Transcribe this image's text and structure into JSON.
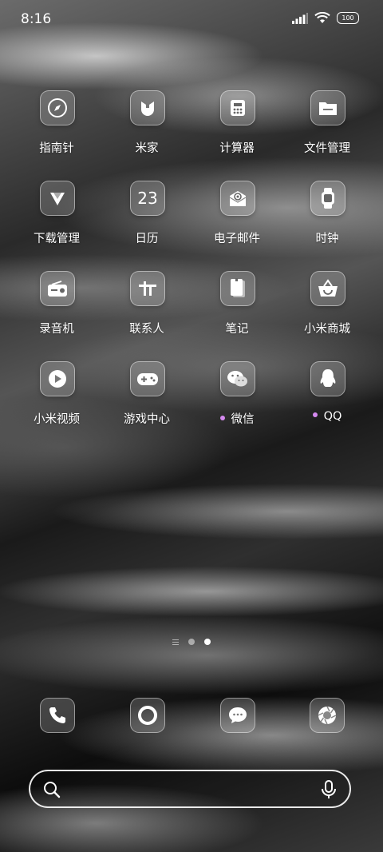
{
  "status_bar": {
    "time": "8:16",
    "battery": "100"
  },
  "apps": [
    {
      "label": "指南针",
      "icon": "compass-icon"
    },
    {
      "label": "米家",
      "icon": "mijia-icon"
    },
    {
      "label": "计算器",
      "icon": "calculator-icon"
    },
    {
      "label": "文件管理",
      "icon": "folder-icon"
    },
    {
      "label": "下载管理",
      "icon": "download-icon"
    },
    {
      "label": "日历",
      "icon": "calendar-icon",
      "icon_text": "23"
    },
    {
      "label": "电子邮件",
      "icon": "email-icon"
    },
    {
      "label": "时钟",
      "icon": "watch-icon"
    },
    {
      "label": "录音机",
      "icon": "radio-recorder-icon"
    },
    {
      "label": "联系人",
      "icon": "contacts-icon"
    },
    {
      "label": "笔记",
      "icon": "notes-icon"
    },
    {
      "label": "小米商城",
      "icon": "shopping-bag-icon"
    },
    {
      "label": "小米视频",
      "icon": "play-icon"
    },
    {
      "label": "游戏中心",
      "icon": "gamepad-icon"
    },
    {
      "label": "微信",
      "icon": "wechat-icon",
      "new_dot": true
    },
    {
      "label": "QQ",
      "icon": "qq-penguin-icon",
      "new_dot": true
    }
  ],
  "dock": [
    {
      "icon": "phone-icon"
    },
    {
      "icon": "browser-ring-icon"
    },
    {
      "icon": "message-bubble-icon"
    },
    {
      "icon": "camera-aperture-icon"
    }
  ],
  "page_indicator": {
    "pages": 2,
    "active": 1
  },
  "colors": {
    "new_dot": "#d58af0"
  }
}
